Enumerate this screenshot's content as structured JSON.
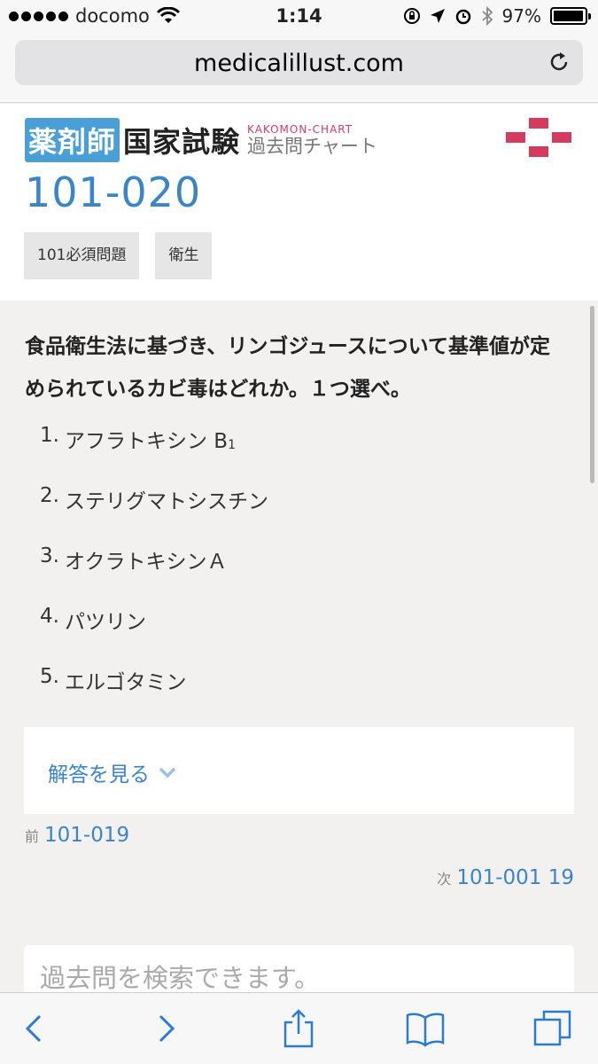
{
  "status_bar": {
    "carrier": "docomo",
    "time": "1:14",
    "battery": "97%",
    "battery_level": 0.97
  },
  "browser": {
    "url": "medicalillust.com"
  },
  "header": {
    "logo_box": "薬剤師",
    "logo_main": "国家試験",
    "logo_sub_en": "KAKOMON-CHART",
    "logo_sub_jp": "過去問チャート"
  },
  "page": {
    "title": "101-020",
    "tags": [
      "101必須問題",
      "衛生"
    ]
  },
  "question": {
    "text": "食品衛生法に基づき、リンゴジュースについて基準値が定められているカビ毒はどれか。１つ選べ。",
    "choices": [
      {
        "num": "1.",
        "label": "アフラトキシン B",
        "sub": "1"
      },
      {
        "num": "2.",
        "label": "ステリグマトシスチン",
        "sub": ""
      },
      {
        "num": "3.",
        "label": "オクラトキシンＡ",
        "sub": ""
      },
      {
        "num": "4.",
        "label": "パツリン",
        "sub": ""
      },
      {
        "num": "5.",
        "label": "エルゴタミン",
        "sub": ""
      }
    ]
  },
  "answer": {
    "label": "解答を見る"
  },
  "nav": {
    "prev_label": "前",
    "prev_link": "101-019",
    "next_label": "次",
    "next_link": "101-001 19"
  },
  "search": {
    "placeholder": "過去問を検索できます。"
  },
  "toolbar": [
    "back-icon",
    "forward-icon",
    "share-icon",
    "bookmarks-icon",
    "tabs-icon"
  ],
  "colors": {
    "accent": "#3a85c8",
    "brand_red": "#d63a5f",
    "logo_blue": "#4a9fd6"
  }
}
